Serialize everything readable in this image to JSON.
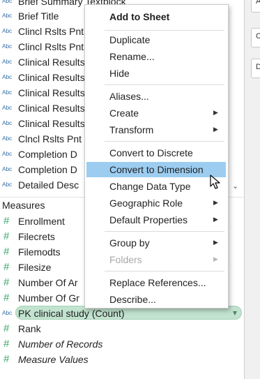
{
  "dimensions": [
    {
      "icon": "Abc",
      "label": "Brief Summary Textblock"
    },
    {
      "icon": "Abc",
      "label": "Brief Title"
    },
    {
      "icon": "Abc",
      "label": "Clincl Rslts Pnt"
    },
    {
      "icon": "Abc",
      "label": "Clincl Rslts Pnt"
    },
    {
      "icon": "Abc",
      "label": "Clinical Results"
    },
    {
      "icon": "Abc",
      "label": "Clinical Results"
    },
    {
      "icon": "Abc",
      "label": "Clinical Results"
    },
    {
      "icon": "Abc",
      "label": "Clinical Results"
    },
    {
      "icon": "Abc",
      "label": "Clinical Results"
    },
    {
      "icon": "Abc",
      "label": "Clncl Rslts Pnt"
    },
    {
      "icon": "Abc",
      "label": "Completion D"
    },
    {
      "icon": "Abc",
      "label": "Completion D"
    },
    {
      "icon": "Abc",
      "label": "Detailed Desc"
    }
  ],
  "measures_header": "Measures",
  "measures": [
    {
      "icon": "#",
      "label": "Enrollment"
    },
    {
      "icon": "#",
      "label": "Filecrets"
    },
    {
      "icon": "#",
      "label": "Filemodts"
    },
    {
      "icon": "#",
      "label": "Filesize"
    },
    {
      "icon": "#",
      "label": "Number Of Ar"
    },
    {
      "icon": "#",
      "label": "Number Of Gr"
    },
    {
      "icon": "Abc",
      "label": "PK clinical study (Count)"
    },
    {
      "icon": "#",
      "label": "Rank"
    },
    {
      "icon": "#",
      "label": "Number of Records"
    },
    {
      "icon": "#",
      "label": "Measure Values"
    }
  ],
  "right_panel": {
    "box1": "Ar",
    "box2": "C",
    "box3": "D"
  },
  "menu": {
    "add_to_sheet": "Add to Sheet",
    "duplicate": "Duplicate",
    "rename": "Rename...",
    "hide": "Hide",
    "aliases": "Aliases...",
    "create": "Create",
    "transform": "Transform",
    "convert_discrete": "Convert to Discrete",
    "convert_dimension": "Convert to Dimension",
    "change_data_type": "Change Data Type",
    "geographic_role": "Geographic Role",
    "default_properties": "Default Properties",
    "group_by": "Group by",
    "folders": "Folders",
    "replace_references": "Replace References...",
    "describe": "Describe..."
  },
  "colors": {
    "highlight": "#9ccdf1",
    "pill": "#c2e3cf",
    "string_icon": "#3a72a8",
    "measure_icon": "#3aa86a"
  }
}
